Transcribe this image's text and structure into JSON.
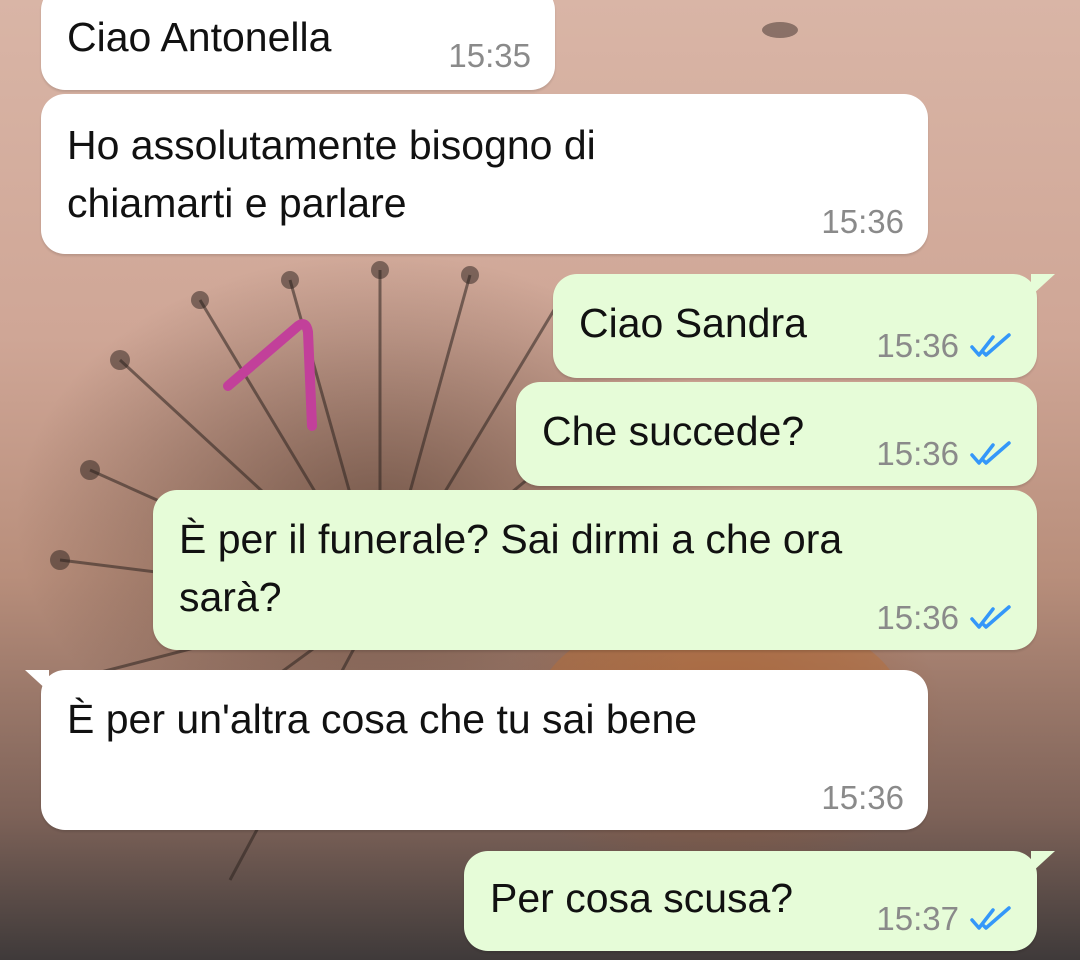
{
  "conversation": {
    "messages": [
      {
        "direction": "incoming",
        "text": "Ciao Antonella",
        "time": "15:35"
      },
      {
        "direction": "incoming",
        "text": "Ho assolutamente bisogno di\nchiamarti e parlare",
        "time": "15:36"
      },
      {
        "direction": "outgoing",
        "text": "Ciao Sandra",
        "time": "15:36",
        "status": "read"
      },
      {
        "direction": "outgoing",
        "text": "Che succede?",
        "time": "15:36",
        "status": "read"
      },
      {
        "direction": "outgoing",
        "text": "È per il funerale? Sai dirmi a che ora\nsarà?",
        "time": "15:36",
        "status": "read"
      },
      {
        "direction": "incoming",
        "text": "È per un'altra cosa che tu sai bene",
        "time": "15:36"
      },
      {
        "direction": "outgoing",
        "text": "Per cosa scusa?",
        "time": "15:37",
        "status": "read"
      }
    ]
  },
  "colors": {
    "incoming_bubble": "#ffffff",
    "outgoing_bubble": "#e6fcd8",
    "read_tick": "#3497f9",
    "timestamp": "#8a8a8a",
    "annotation_stroke": "#c2409a"
  },
  "icons": {
    "read_receipt": "double-check-icon",
    "annotation": "hand-drawn-arrow-icon"
  }
}
